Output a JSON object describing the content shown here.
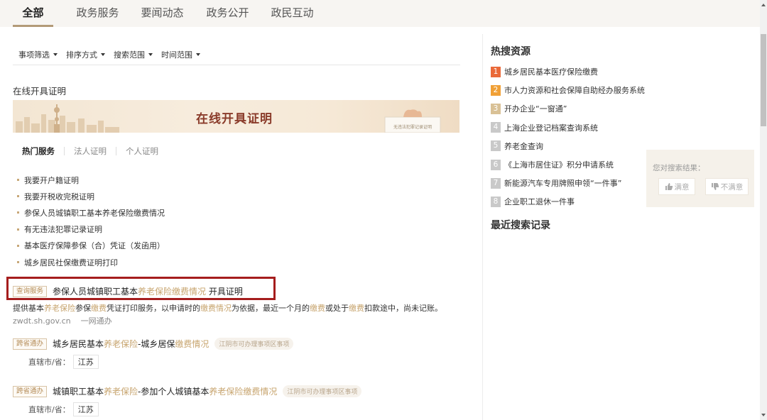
{
  "top_tabs": [
    "全部",
    "政务服务",
    "要闻动态",
    "政务公开",
    "政民互动"
  ],
  "filters": [
    "事项筛选",
    "排序方式",
    "搜索范围",
    "时间范围"
  ],
  "section_title": "在线开具证明",
  "banner": {
    "title": "在线开具证明",
    "card_text": "无违法犯罪记录证明"
  },
  "sub_tabs": [
    "热门服务",
    "法人证明",
    "个人证明"
  ],
  "service_items": [
    "我要开户籍证明",
    "我要开税收完税证明",
    "参保人员城镇职工基本养老保险缴费情况",
    "有无违法犯罪记录证明",
    "基本医疗保障参保（合）凭证（发函用）",
    "城乡居民社保缴费证明打印"
  ],
  "results": [
    {
      "tag": "查询服务",
      "title_parts": [
        "参保人员城镇职工基本",
        "养老保险缴费情况",
        " 开具证明"
      ],
      "desc_parts": [
        "提供基本",
        "养老保险",
        "参保",
        "缴费",
        "凭证打印服务，以申请时的",
        "缴费情况",
        "为依据，最近一个月的",
        "缴费",
        "或处于",
        "缴费",
        "扣款途中，尚未记账。"
      ],
      "source_url": "zwdt.sh.gov.cn",
      "source_name": "一网通办"
    },
    {
      "tag": "跨省通办",
      "title_parts": [
        "城乡居民基本",
        "养老保险",
        "-城乡居保",
        "缴费情况"
      ],
      "tail_tag": "江阴市可办理事项区事项",
      "region_label": "直辖市/省：",
      "region_value": "江苏"
    },
    {
      "tag": "跨省通办",
      "title_parts": [
        "城镇职工基本",
        "养老保险",
        "-参加个人城镇基本",
        "养老保险缴费情况"
      ],
      "tail_tag": "江阴市可办理事项区事项",
      "region_label": "直辖市/省：",
      "region_value": "江苏"
    }
  ],
  "hot_title": "热搜资源",
  "hot_items": [
    {
      "rank": "1",
      "label": "城乡居民基本医疗保险缴费"
    },
    {
      "rank": "2",
      "label": "市人力资源和社会保障自助经办服务系统"
    },
    {
      "rank": "3",
      "label": "开办企业“一窗通”"
    },
    {
      "rank": "4",
      "label": "上海企业登记档案查询系统"
    },
    {
      "rank": "5",
      "label": "养老金查询"
    },
    {
      "rank": "6",
      "label": "《上海市居住证》积分申请系统"
    },
    {
      "rank": "7",
      "label": "新能源汽车专用牌照申领“一件事”"
    },
    {
      "rank": "8",
      "label": "企业职工退休一件事"
    }
  ],
  "recent_title": "最近搜索记录",
  "feedback": {
    "question": "您对搜索结果：",
    "satisfied": "满意",
    "unsatisfied": "不满意"
  },
  "colors": {
    "accent": "#b39a78",
    "highlight_text": "#c7a46e",
    "box_red": "#a51d1d"
  }
}
